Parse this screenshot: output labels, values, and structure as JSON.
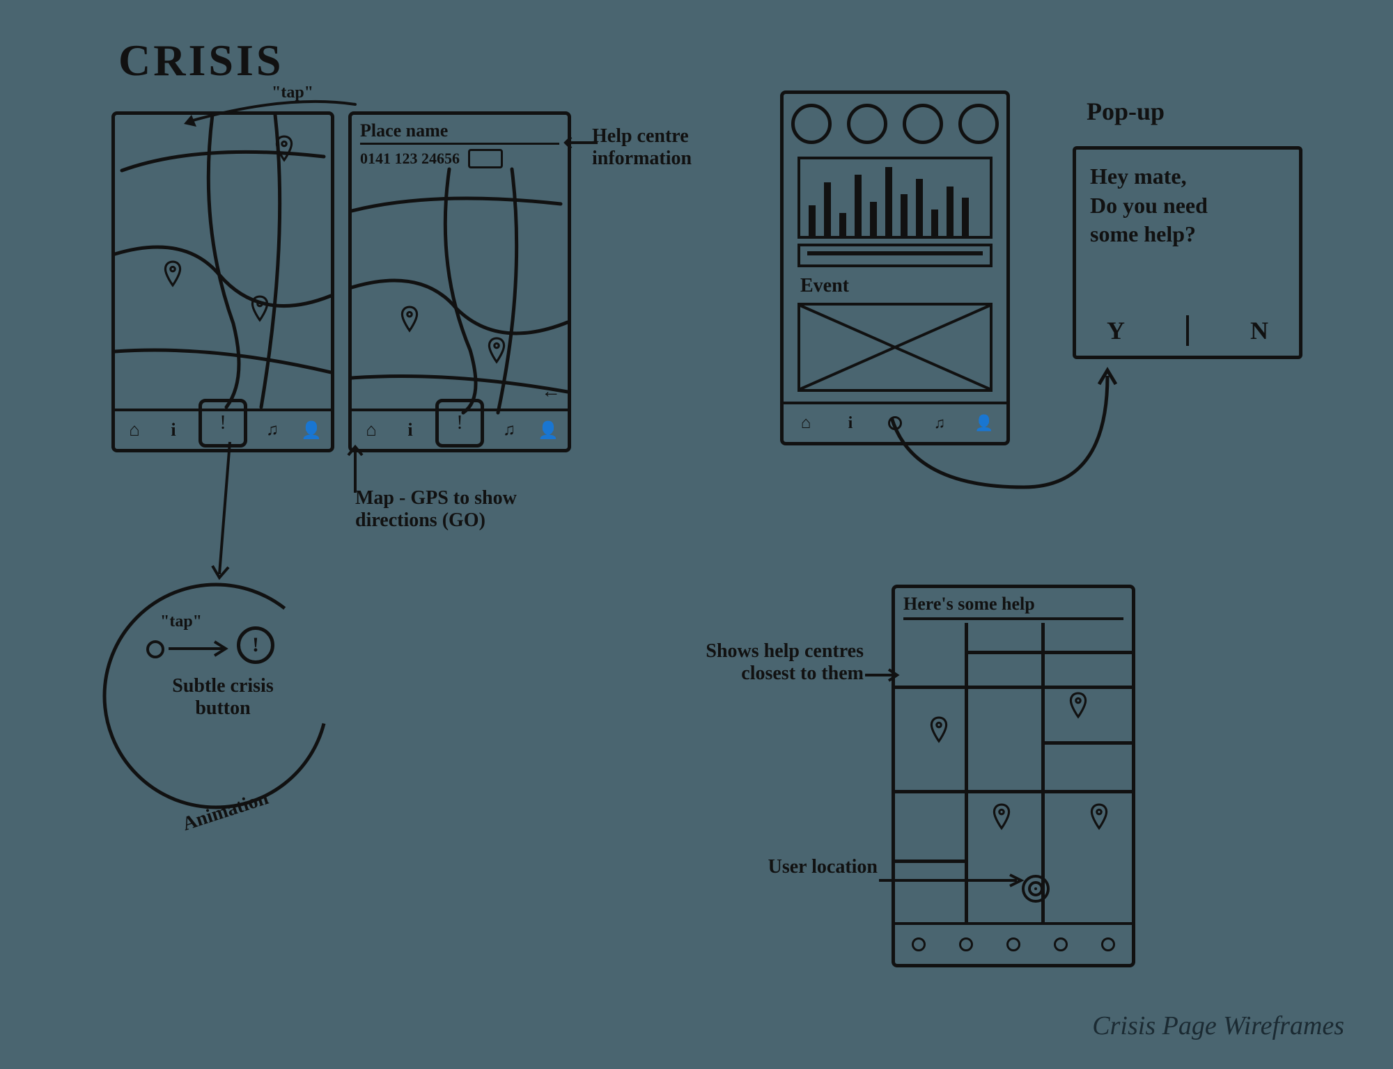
{
  "title": "CRISIS",
  "caption": "Crisis Page Wireframes",
  "annotations": {
    "tap_top": "\"tap\"",
    "help_centre_info": "Help centre information",
    "map_gps": "Map - GPS to show directions (GO)",
    "tap_circle": "\"tap\"",
    "subtle_button": "Subtle crisis button",
    "animation": "Animation",
    "popup_label": "Pop-up",
    "shows_centres": "Shows help centres closest to them",
    "user_location": "User location"
  },
  "screen_detail": {
    "place_name": "Place name",
    "phone_number": "0141 123 24656"
  },
  "dashboard": {
    "event_label": "Event"
  },
  "popup": {
    "line1": "Hey mate,",
    "line2": "Do you need",
    "line3": "some help?",
    "yes": "Y",
    "no": "N"
  },
  "help_screen": {
    "header": "Here's some help"
  }
}
